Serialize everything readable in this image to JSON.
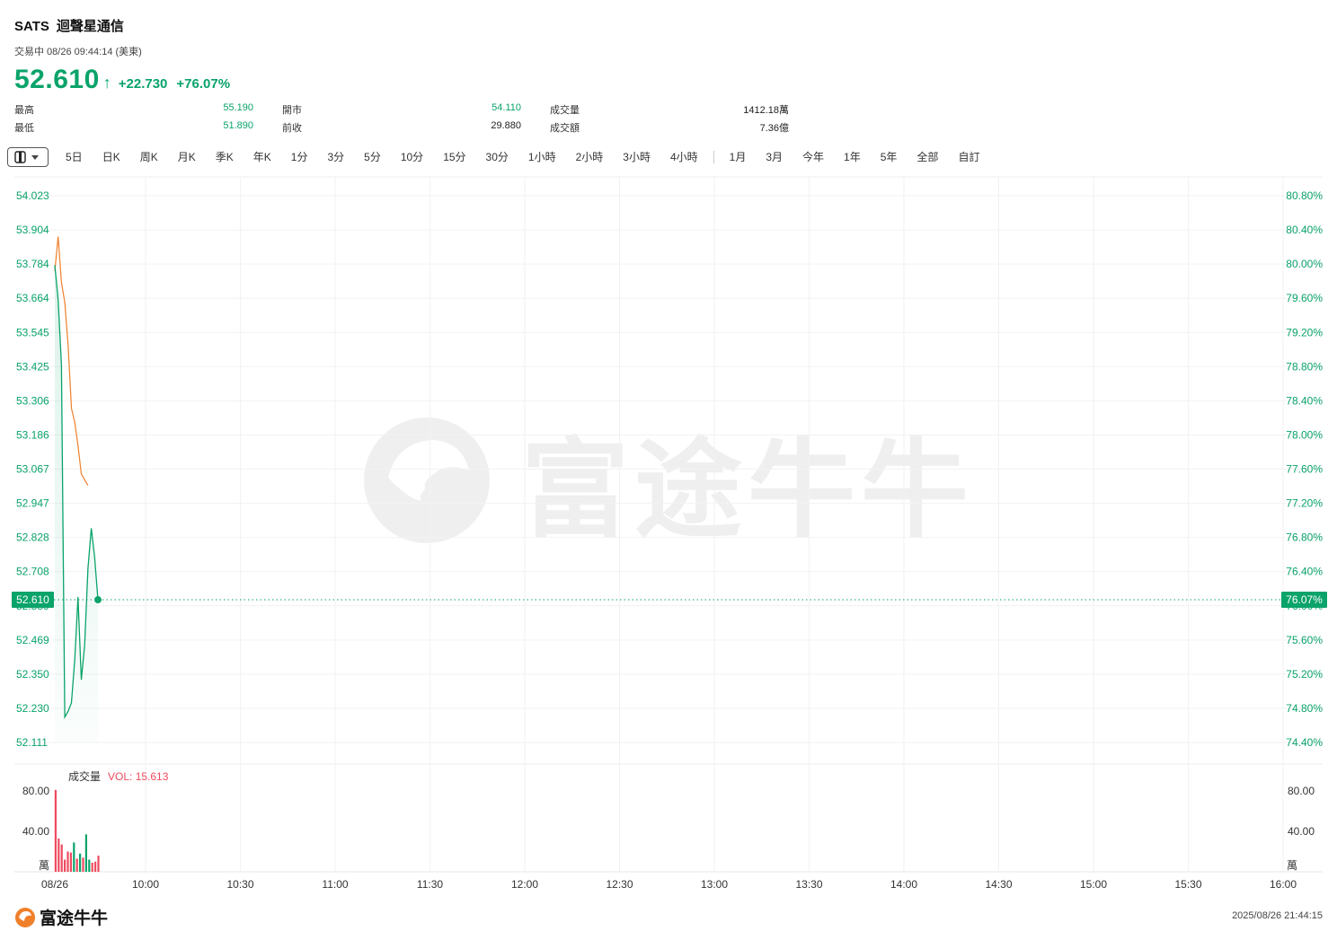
{
  "header": {
    "symbol": "SATS",
    "name": "迴聲星通信",
    "status": "交易中 08/26 09:44:14 (美東)",
    "price": "52.610",
    "change": "+22.730",
    "change_pct": "+76.07%"
  },
  "stats": [
    {
      "label": "最高",
      "value": "55.190"
    },
    {
      "label": "最低",
      "value": "51.890"
    },
    {
      "label": "開市",
      "value": "54.110"
    },
    {
      "label": "前收",
      "value": "29.880"
    },
    {
      "label": "成交量",
      "value": "1412.18萬"
    },
    {
      "label": "成交額",
      "value": "7.36億"
    }
  ],
  "tabs": [
    "5日",
    "日K",
    "周K",
    "月K",
    "季K",
    "年K",
    "1分",
    "3分",
    "5分",
    "10分",
    "15分",
    "30分",
    "1小時",
    "2小時",
    "3小時",
    "4小時",
    "1月",
    "3月",
    "今年",
    "1年",
    "5年",
    "全部",
    "自訂"
  ],
  "footer": {
    "brand": "富途牛牛",
    "timestamp": "2025/08/26 21:44:15"
  },
  "colors": {
    "up": "#0aa36a",
    "down": "#ee4b5f",
    "avg": "#f07f2a"
  },
  "chart_data": {
    "type": "line",
    "x_tick_labels": [
      "08/26",
      "10:00",
      "10:30",
      "11:00",
      "11:30",
      "12:00",
      "12:30",
      "13:00",
      "13:30",
      "14:00",
      "14:30",
      "15:00",
      "15:30",
      "16:00"
    ],
    "y_tick_labels": [
      "54.023",
      "53.904",
      "53.784",
      "53.664",
      "53.545",
      "53.425",
      "53.306",
      "53.186",
      "53.067",
      "52.947",
      "52.828",
      "52.708",
      "52.589",
      "52.469",
      "52.350",
      "52.230",
      "52.111"
    ],
    "y_pct_tick_labels": [
      "80.80%",
      "80.40%",
      "80.00%",
      "79.60%",
      "79.20%",
      "78.80%",
      "78.40%",
      "78.00%",
      "77.60%",
      "77.20%",
      "76.80%",
      "76.40%",
      "76.00%",
      "75.60%",
      "75.20%",
      "74.80%",
      "74.40%"
    ],
    "ylim": [
      52.111,
      54.023
    ],
    "current_price": "52.610",
    "current_pct": "76.07%",
    "series": [
      {
        "values": [
          53.78,
          53.66,
          53.43,
          52.2,
          52.22,
          52.25,
          52.4,
          52.62,
          52.33,
          52.45,
          52.72,
          52.86,
          52.76,
          52.61
        ]
      },
      {
        "values": [
          53.76,
          53.88,
          53.72,
          53.65,
          53.5,
          53.28,
          53.23,
          53.15,
          53.05,
          53.03,
          53.01
        ]
      }
    ],
    "volume": {
      "label": "成交量",
      "value_label": "VOL: 15.613",
      "y_tick_labels": [
        "80.00",
        "40.00"
      ],
      "unit": "萬",
      "ylim": [
        0,
        80
      ],
      "bars": [
        {
          "v": 81,
          "c": "down"
        },
        {
          "v": 33,
          "c": "down"
        },
        {
          "v": 27,
          "c": "down"
        },
        {
          "v": 12,
          "c": "down"
        },
        {
          "v": 20,
          "c": "down"
        },
        {
          "v": 19,
          "c": "down"
        },
        {
          "v": 29,
          "c": "up"
        },
        {
          "v": 13,
          "c": "down"
        },
        {
          "v": 18,
          "c": "up"
        },
        {
          "v": 14,
          "c": "down"
        },
        {
          "v": 37,
          "c": "up"
        },
        {
          "v": 12,
          "c": "up"
        },
        {
          "v": 9,
          "c": "down"
        },
        {
          "v": 10,
          "c": "down"
        },
        {
          "v": 16,
          "c": "down"
        }
      ]
    }
  }
}
